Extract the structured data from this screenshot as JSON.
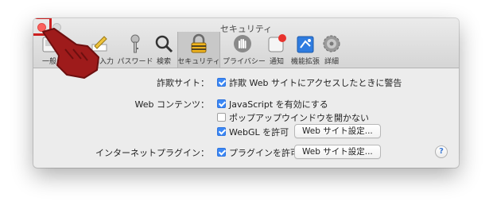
{
  "window": {
    "title": "セキュリティ"
  },
  "toolbar": {
    "items": [
      {
        "label": "一般",
        "icon": "general-switch-icon"
      },
      {
        "label": "自動入力",
        "icon": "autofill-pencil-icon"
      },
      {
        "label": "パスワード",
        "icon": "key-icon"
      },
      {
        "label": "検索",
        "icon": "magnifier-icon"
      },
      {
        "label": "セキュリティ",
        "icon": "lock-icon",
        "selected": true
      },
      {
        "label": "プライバシー",
        "icon": "hand-icon"
      },
      {
        "label": "通知",
        "icon": "notification-badge-icon"
      },
      {
        "label": "機能拡張",
        "icon": "puzzle-icon"
      },
      {
        "label": "詳細",
        "icon": "gear-icon"
      }
    ]
  },
  "security": {
    "fraud_label": "詐欺サイト：",
    "fraud_option": "詐欺 Web サイトにアクセスしたときに警告",
    "web_content_label": "Web コンテンツ：",
    "javascript_option": "JavaScript を有効にする",
    "popup_option": "ポップアップウインドウを開かない",
    "webgl_option": "WebGL を許可",
    "webgl_button": "Web サイト設定...",
    "plugins_label": "インターネットプラグイン：",
    "plugins_option": "プラグインを許可",
    "plugins_button": "Web サイト設定...",
    "help": "?"
  },
  "colors": {
    "accent": "#3b88f6",
    "highlight": "#cc1f1f"
  }
}
